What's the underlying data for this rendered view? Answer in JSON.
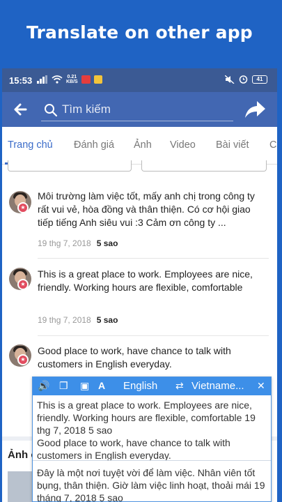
{
  "banner": {
    "title": "Translate on other app"
  },
  "status_bar": {
    "time": "15:53",
    "speed_top": "0.21",
    "speed_bottom": "KB/S",
    "battery": "41"
  },
  "navbar": {
    "search_placeholder": "Tìm kiếm"
  },
  "tabs": [
    {
      "label": "Trang chủ",
      "active": true
    },
    {
      "label": "Đánh giá"
    },
    {
      "label": "Ảnh"
    },
    {
      "label": "Video"
    },
    {
      "label": "Bài viết"
    },
    {
      "label": "C"
    }
  ],
  "reviews": [
    {
      "text": "Môi trường làm việc tốt, mấy anh chị trong công ty rất vui vẻ, hòa đồng và thân thiện. Có cơ hội giao tiếp tiếng Anh siêu vui :3 Cảm ơn công ty ...",
      "date": "19 thg 7, 2018",
      "rating": "5 sao"
    },
    {
      "text": "This is a great place to work. Employees are nice, friendly. Working hours are flexible, comfortable",
      "date": "19 thg 7, 2018",
      "rating": "5 sao"
    },
    {
      "text": "Good place to work, have chance to talk with customers in English everyday.",
      "date": "",
      "rating": ""
    }
  ],
  "bottom_section": {
    "title": "Ảnh c"
  },
  "translator": {
    "source_lang": "English",
    "target_lang": "Vietname...",
    "source_text_1": "This is a great place to work. Employees are nice, friendly. Working hours are flexible, comfortable 19 thg 7, 2018 5 sao",
    "source_text_2": "Good place to work, have chance to talk with customers in English everyday.",
    "target_text": "Đây là một nơi tuyệt vời để làm việc. Nhân viên tốt bụng, thân thiện. Giờ làm việc linh hoạt, thoải mái 19 tháng 7, 2018 5 sao"
  },
  "colors": {
    "banner": "#1f63c4",
    "statusbar": "#3b5a94",
    "navbar": "#4267b2",
    "tab_active": "#3b6cc9",
    "translator_bar": "#3d8fe8",
    "badge": "#e24c5f"
  }
}
